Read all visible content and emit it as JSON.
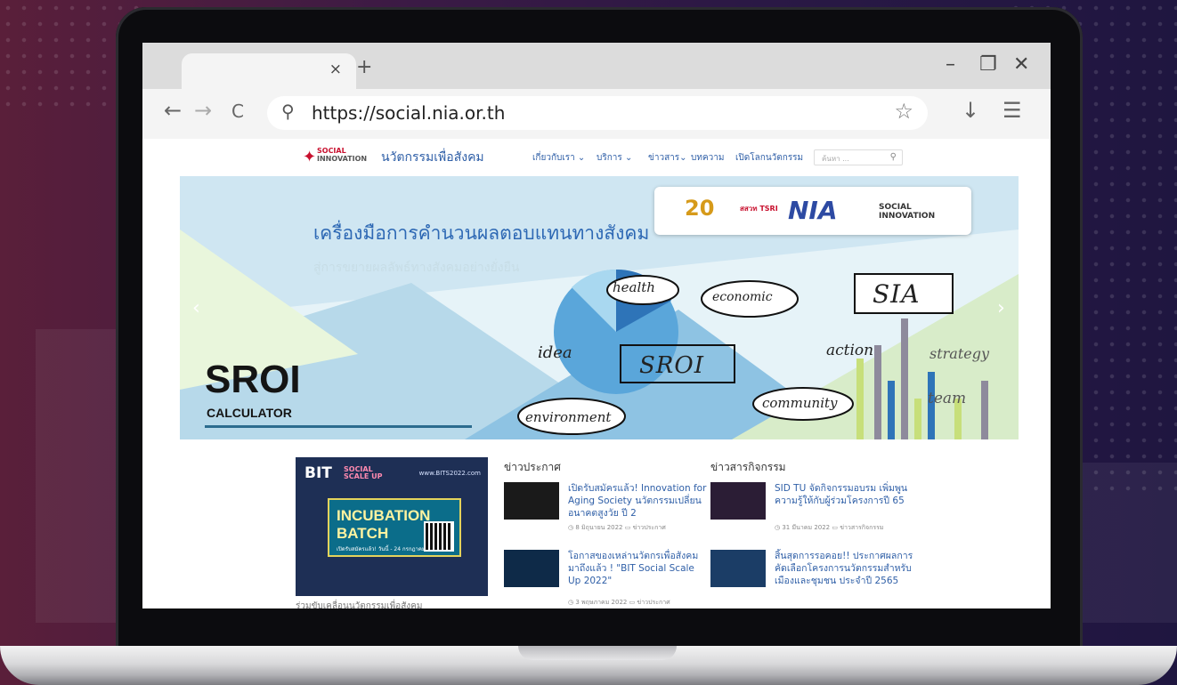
{
  "browser": {
    "tab_close": "×",
    "new_tab": "+",
    "minimize": "–",
    "maximize": "❐",
    "close": "✕",
    "back": "←",
    "forward": "→",
    "reload": "C",
    "search_icon": "⚲",
    "url": "https://social.nia.or.th",
    "bookmark": "☆",
    "download": "↓",
    "menu": "☰"
  },
  "site": {
    "logo_line1": "SOCIAL",
    "logo_line2": "INNOVATION",
    "name": "นวัตกรรมเพื่อสังคม",
    "menu": [
      "เกี่ยวกับเรา ⌄",
      "บริการ ⌄",
      "ข่าวสาร⌄",
      "บทความ",
      "เปิดโลกนวัตกรรม"
    ],
    "search_placeholder": "ค้นหา ...",
    "search_icon": "⚲"
  },
  "hero": {
    "title": "เครื่องมือการคำนวนผลตอบแทนทางสังคม",
    "subtitle": "สู่การขยายผลลัพธ์ทางสังคมอย่างยั่งยืน",
    "big": "SROI",
    "small": "CALCULATOR",
    "center": "SROI",
    "box": "SIA",
    "words": [
      "health",
      "economic",
      "idea",
      "action",
      "strategy",
      "environment",
      "community",
      "team"
    ],
    "partner_logos": [
      "20",
      "สสวท TSRI",
      "NIA",
      "SOCIAL INNOVATION"
    ],
    "prev": "‹",
    "next": "›"
  },
  "banner": {
    "logo": "BIT",
    "social": "SOCIAL\nSCALE UP",
    "url": "www.BITS2022.com",
    "line1": "INCUBATION",
    "line2": "BATCH",
    "date": "เปิดรับสมัครแล้ว! วันนี้ - 24 กรกฎาคม 2565",
    "caption": "ร่วมขับเคลื่อนนวัตกรรมเพื่อสังคม"
  },
  "columns": [
    {
      "heading": "ข่าวประกาศ",
      "items": [
        {
          "title": "เปิดรับสมัครแล้ว! Innovation for Aging Society นวัตกรรมเปลี่ยนอนาคตสูงวัย ปี 2",
          "meta": "◷ 8 มิถุนายน 2022  ▭ ข่าวประกาศ"
        },
        {
          "title": "โอกาสของเหล่านวัตกรเพื่อสังคม มาถึงแล้ว ! \"BIT Social Scale Up 2022\"",
          "meta": "◷ 3 พฤษภาคม 2022  ▭ ข่าวประกาศ"
        }
      ]
    },
    {
      "heading": "ข่าวสารกิจกรรม",
      "items": [
        {
          "title": "SID TU จัดกิจกรรมอบรม เพิ่มพูนความรู้ให้กับผู้ร่วมโครงการปี 65",
          "meta": "◷ 31 มีนาคม 2022  ▭ ข่าวสารกิจกรรม"
        },
        {
          "title": "สิ้นสุดการรอคอย!! ประกาศผลการคัดเลือกโครงการนวัตกรรมสำหรับเมืองและชุมชน ประจำปี 2565",
          "meta": ""
        }
      ]
    }
  ]
}
